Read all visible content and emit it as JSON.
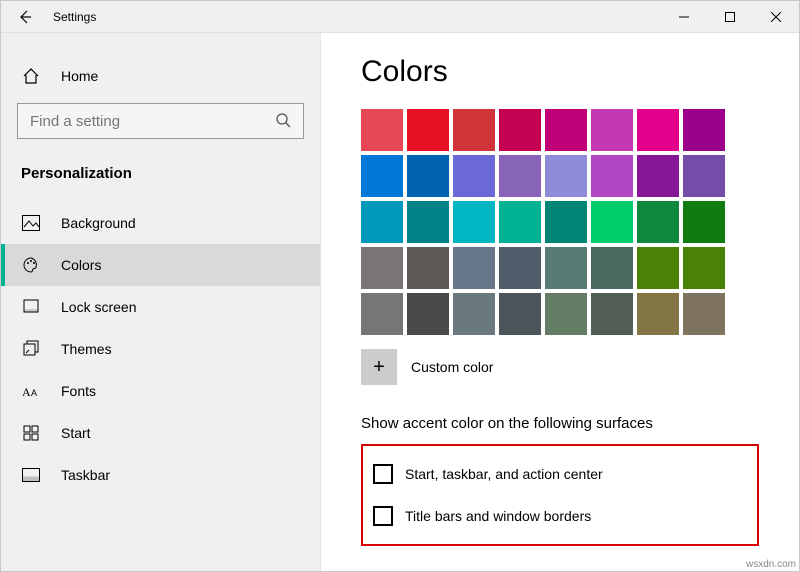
{
  "window": {
    "title": "Settings"
  },
  "sidebar": {
    "home": "Home",
    "search_placeholder": "Find a setting",
    "category": "Personalization",
    "items": [
      {
        "label": "Background",
        "icon": "image-icon",
        "selected": false
      },
      {
        "label": "Colors",
        "icon": "palette-icon",
        "selected": true
      },
      {
        "label": "Lock screen",
        "icon": "lockscreen-icon",
        "selected": false
      },
      {
        "label": "Themes",
        "icon": "themes-icon",
        "selected": false
      },
      {
        "label": "Fonts",
        "icon": "fonts-icon",
        "selected": false
      },
      {
        "label": "Start",
        "icon": "start-icon",
        "selected": false
      },
      {
        "label": "Taskbar",
        "icon": "taskbar-icon",
        "selected": false
      }
    ]
  },
  "main": {
    "heading": "Colors",
    "palette": [
      [
        "#e74856",
        "#e81123",
        "#d13438",
        "#c30052",
        "#bf0077",
        "#c239b3",
        "#e3008c",
        "#9a0089"
      ],
      [
        "#0078d7",
        "#0063b1",
        "#6b69d6",
        "#8764b8",
        "#8e8cd8",
        "#b146c2",
        "#881798",
        "#744da9"
      ],
      [
        "#0099bc",
        "#038387",
        "#00b7c3",
        "#00b294",
        "#018574",
        "#00cc6a",
        "#10893e",
        "#107c10"
      ],
      [
        "#7a7574",
        "#5d5a58",
        "#68768a",
        "#515c6b",
        "#567c73",
        "#486860",
        "#498205",
        "#498205"
      ],
      [
        "#767676",
        "#4c4a48",
        "#69797e",
        "#4a5459",
        "#647c64",
        "#525e54",
        "#847545",
        "#7e735f"
      ]
    ],
    "custom_color_label": "Custom color",
    "surfaces_heading": "Show accent color on the following surfaces",
    "checkboxes": [
      {
        "label": "Start, taskbar, and action center",
        "checked": false
      },
      {
        "label": "Title bars and window borders",
        "checked": false
      }
    ]
  },
  "watermark": "wsxdn.com"
}
